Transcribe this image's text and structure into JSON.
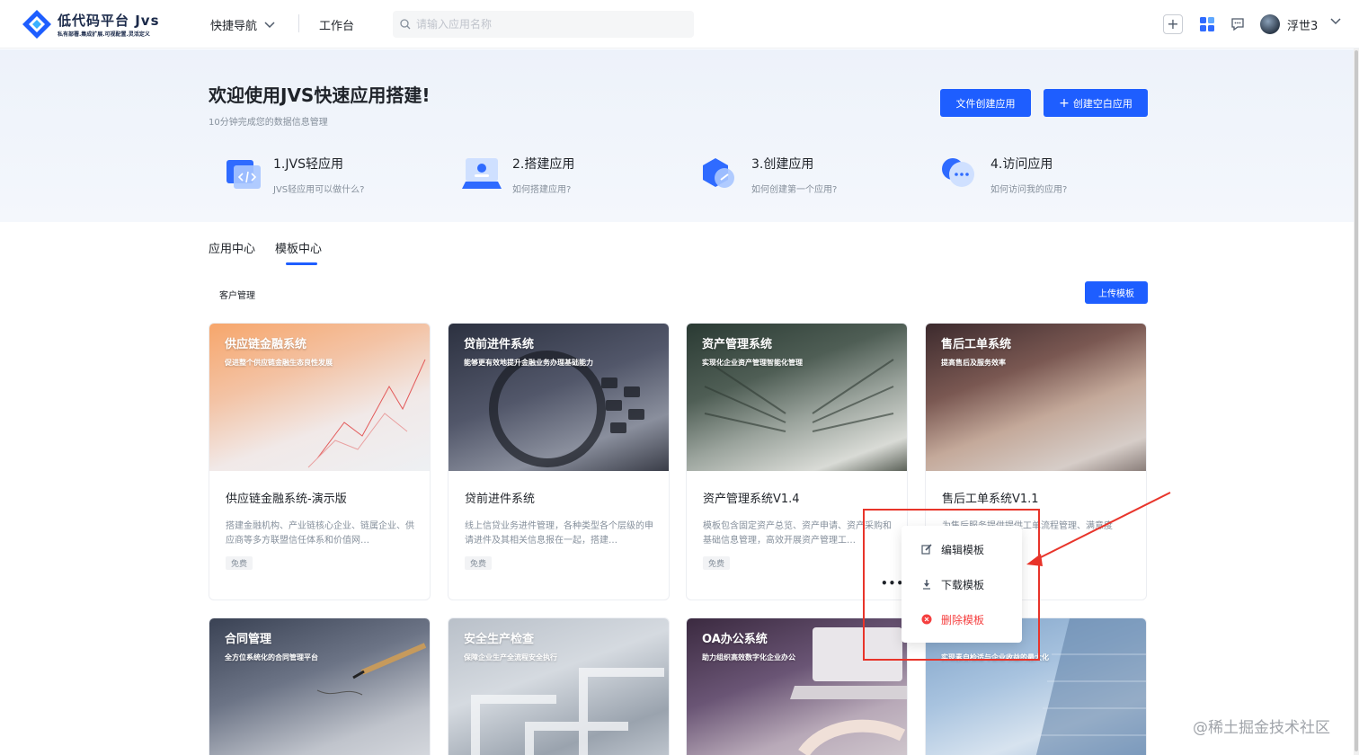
{
  "app": {
    "logo_title": "低代码平台 Jvs",
    "logo_subtitle": "私有部署.集成扩展.可视配置.灵活定义"
  },
  "nav": {
    "quick_nav": "快捷导航",
    "workbench": "工作台"
  },
  "search": {
    "placeholder": "请输入应用名称"
  },
  "user": {
    "name": "浮世3"
  },
  "hero": {
    "title": "欢迎使用JVS快速应用搭建!",
    "subtitle": "10分钟完成您的数据信息管理",
    "btn_file": "文件创建应用",
    "btn_blank": "创建空白应用",
    "steps": [
      {
        "title": "1.JVS轻应用",
        "desc": "JVS轻应用可以做什么?"
      },
      {
        "title": "2.搭建应用",
        "desc": "如何搭建应用?"
      },
      {
        "title": "3.创建应用",
        "desc": "如何创建第一个应用?"
      },
      {
        "title": "4.访问应用",
        "desc": "如何访问我的应用?"
      }
    ]
  },
  "tabs": [
    {
      "label": "应用中心",
      "active": false
    },
    {
      "label": "模板中心",
      "active": true
    }
  ],
  "filter_label": "客户管理",
  "upload_button": "上传模板",
  "cards": [
    {
      "img_title": "供应链金融系统",
      "img_sub": "促进整个供应链金融生态良性发展",
      "name": "供应链金融系统-演示版",
      "desc": "搭建金融机构、产业链核心企业、链属企业、供应商等多方联盟信任体系和价值网…",
      "tag": "免费"
    },
    {
      "img_title": "贷前进件系统",
      "img_sub": "能够更有效地提升金融业务办理基础能力",
      "name": "贷前进件系统",
      "desc": "线上信贷业务进件管理，各种类型各个层级的申请进件及其相关信息报在一起，搭建…",
      "tag": "免费"
    },
    {
      "img_title": "资产管理系统",
      "img_sub": "实现化企业资产管理智能化管理",
      "name": "资产管理系统V1.4",
      "desc": "模板包含固定资产总览、资产申请、资产采购和基础信息管理，高效开展资产管理工…",
      "tag": "免费"
    },
    {
      "img_title": "售后工单系统",
      "img_sub": "提高售后及服务效率",
      "name": "售后工单系统V1.1",
      "desc": "为售后服务提供提供工单流程管理、满意度",
      "tag": ""
    },
    {
      "img_title": "合同管理",
      "img_sub": "全方位系统化的合同管理平台"
    },
    {
      "img_title": "安全生产检查",
      "img_sub": "保障企业生产全流程安全执行"
    },
    {
      "img_title": "OA办公系统",
      "img_sub": "助力组织高效数字化企业办公"
    },
    {
      "img_title": "",
      "img_sub": "实现素自检适与企业收益的最大化"
    }
  ],
  "menu": {
    "edit": "编辑模板",
    "download": "下载模板",
    "delete": "删除模板"
  },
  "more_label": "•••",
  "watermark": "@稀土掘金技术社区",
  "colors": {
    "primary": "#1e5eff",
    "danger": "#f53f3f",
    "annotation": "#e8342a"
  }
}
